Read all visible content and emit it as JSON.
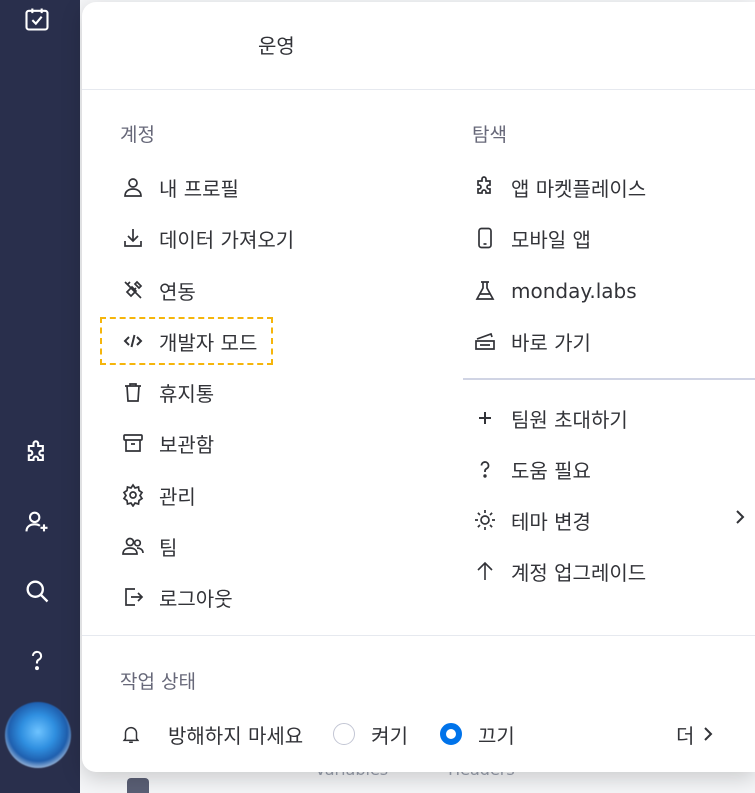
{
  "header": {
    "org_name": "운영"
  },
  "account": {
    "title": "계정",
    "items": [
      {
        "label": "내 프로필",
        "icon": "user-icon"
      },
      {
        "label": "데이터 가져오기",
        "icon": "download-icon"
      },
      {
        "label": "연동",
        "icon": "plug-icon"
      },
      {
        "label": "개발자 모드",
        "icon": "code-icon",
        "highlighted": true
      },
      {
        "label": "휴지통",
        "icon": "trash-icon"
      },
      {
        "label": "보관함",
        "icon": "archive-icon"
      },
      {
        "label": "관리",
        "icon": "gear-icon"
      },
      {
        "label": "팀",
        "icon": "team-icon"
      },
      {
        "label": "로그아웃",
        "icon": "logout-icon"
      }
    ]
  },
  "explore": {
    "title": "탐색",
    "items": [
      {
        "label": "앱 마켓플레이스",
        "icon": "puzzle-icon"
      },
      {
        "label": "모바일 앱",
        "icon": "mobile-icon"
      },
      {
        "label": "monday.labs",
        "icon": "flask-icon"
      },
      {
        "label": "바로 가기",
        "icon": "keyboard-icon"
      }
    ],
    "more_items": [
      {
        "label": "팀원 초대하기",
        "icon": "plus-icon"
      },
      {
        "label": "도움 필요",
        "icon": "question-icon"
      },
      {
        "label": "테마 변경",
        "icon": "sun-icon",
        "has_submenu": true
      },
      {
        "label": "계정 업그레이드",
        "icon": "arrow-up-icon"
      }
    ]
  },
  "work_status": {
    "title": "작업 상태",
    "dnd_label": "방해하지 마세요",
    "on_label": "켜기",
    "off_label": "끄기",
    "selected": "off",
    "more_label": "더"
  },
  "background": {
    "tab1": "Variables",
    "tab2": "Headers"
  },
  "colors": {
    "sidebar": "#292f4c",
    "accent": "#0073ea",
    "highlight_border": "#f5b50c"
  }
}
